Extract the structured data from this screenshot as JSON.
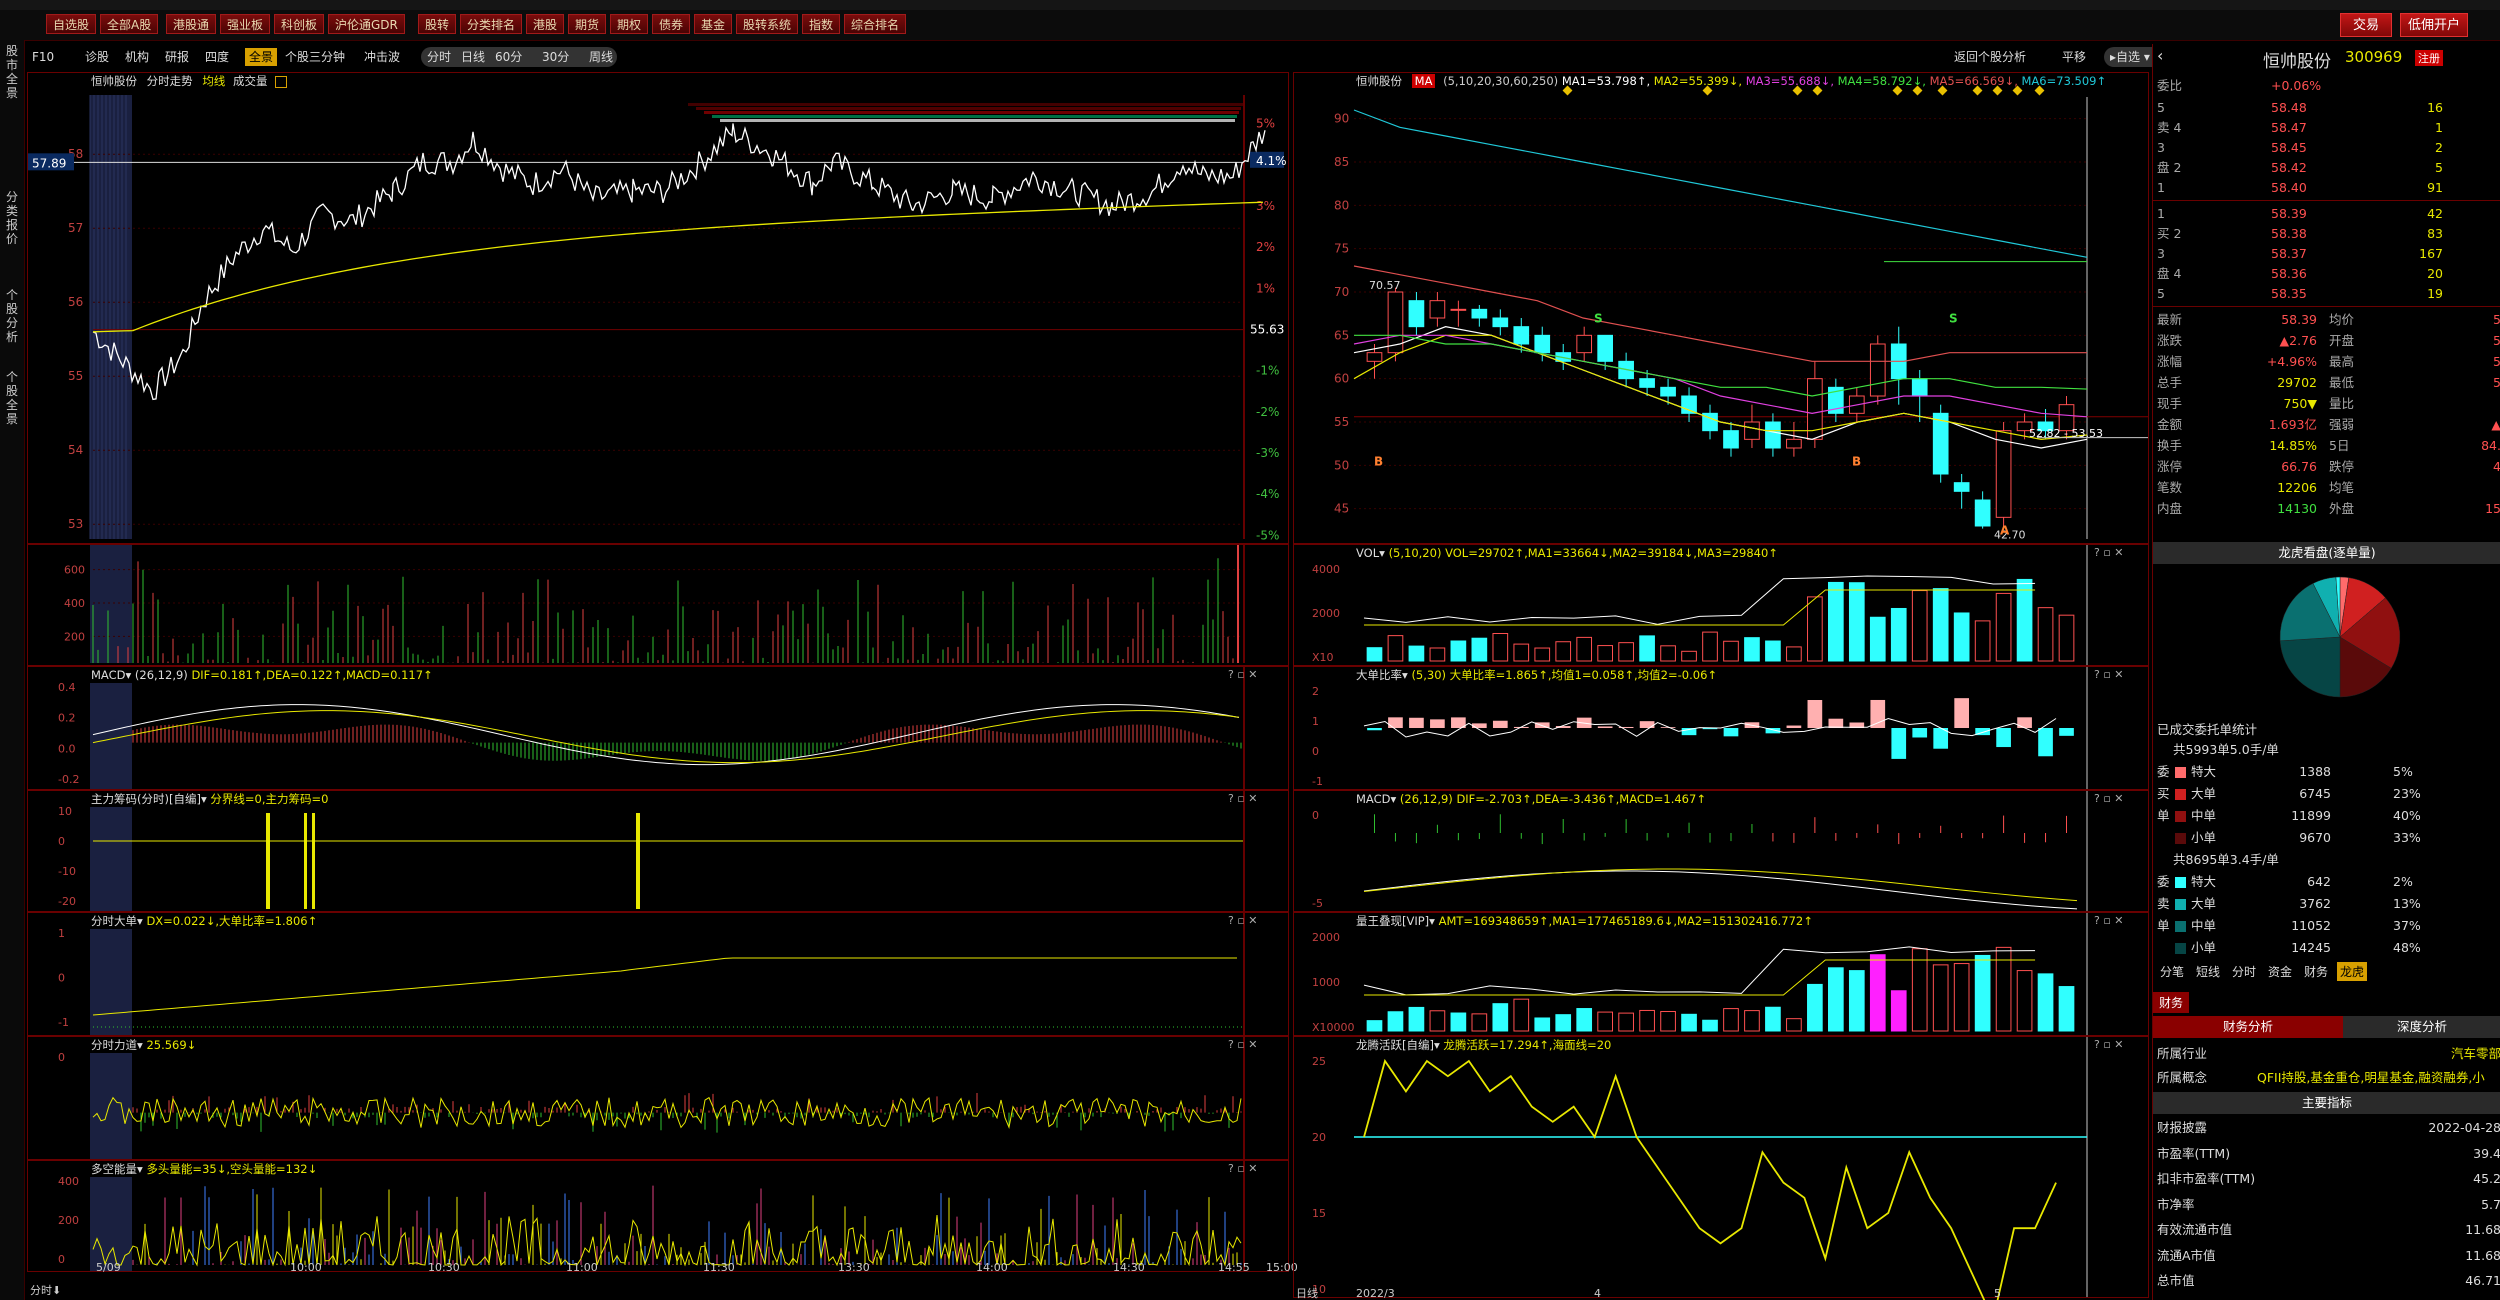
{
  "menubar": {
    "items": [
      "自选股",
      "全部A股",
      "港股通",
      "强业板",
      "科创板",
      "沪伦通GDR",
      "股转",
      "分类排名",
      "港股",
      "期货",
      "期权",
      "债券",
      "基金",
      "股转系统",
      "指数",
      "综合排名"
    ],
    "trade_btn": "交易",
    "open_btn": "低佣开户"
  },
  "vtabs": [
    "股市全景",
    "分类报价",
    "个股分析",
    "个股全景"
  ],
  "toolbar": {
    "left_items": [
      "F10",
      "诊股",
      "机构",
      "研报",
      "四度",
      "全景",
      "个股三分钟",
      "冲击波"
    ],
    "selected": "全景",
    "periods": [
      "分时",
      "日线",
      "60分",
      "30分",
      "周线"
    ],
    "right_items": [
      "返回个股分析",
      "平移",
      "自选"
    ]
  },
  "intraday": {
    "header": {
      "name": "恒帅股份",
      "chart": "分时走势",
      "avg": "均线",
      "vol": "成交量"
    },
    "price_labels": [
      "58",
      "57",
      "56",
      "55",
      "54",
      "53"
    ],
    "pct_labels": [
      "5%",
      "4.1%",
      "3%",
      "2%",
      "1%",
      "-1%",
      "-2%",
      "-3%",
      "-4%",
      "-5%"
    ],
    "ref_price": "55.63",
    "cursor_price": "57.89",
    "vol_labels": [
      "600",
      "400",
      "200"
    ],
    "time_labels": [
      "5/09",
      "10:00",
      "10:30",
      "11:00",
      "11:30",
      "13:30",
      "14:00",
      "14:30",
      "14:55",
      "15:00"
    ],
    "bottom_left": "分时"
  },
  "indicators_left": [
    {
      "name": "MACD",
      "params": "(26,12,9)",
      "vals": "DIF=0.181↑,DEA=0.122↑,MACD=0.117↑",
      "ylabels": [
        "0.4",
        "0.2",
        "0.0",
        "-0.2"
      ]
    },
    {
      "name": "主力筹码(分时)[自编]",
      "params": "",
      "vals": "分界线=0,主力筹码=0",
      "ylabels": [
        "10",
        "0",
        "-10",
        "-20"
      ]
    },
    {
      "name": "分时大单",
      "params": "",
      "vals": "DX=0.022↓,大单比率=1.806↑",
      "ylabels": [
        "1",
        "0",
        "-1"
      ]
    },
    {
      "name": "分时力道",
      "params": "",
      "vals": "25.569↓",
      "ylabels": [
        "0"
      ]
    },
    {
      "name": "多空能量",
      "params": "",
      "vals": "多头量能=35↓,空头量能=132↓",
      "ylabels": [
        "400",
        "200",
        "0"
      ]
    }
  ],
  "daily": {
    "header": {
      "name": "恒帅股份",
      "ma": "MA",
      "params": "(5,10,20,30,60,250)",
      "vals": [
        "MA1=53.798↑",
        "MA2=55.399↓",
        "MA3=55.688↓",
        "MA4=58.792↓",
        "MA5=66.569↓",
        "MA6=73.509↑"
      ]
    },
    "price_labels": [
      "90",
      "85",
      "80",
      "75",
      "70",
      "65",
      "60",
      "55",
      "50",
      "45"
    ],
    "high_label": "70.57",
    "low_label": "42.70",
    "range_label": "52.82 - 53.53",
    "date_labels": [
      "日线",
      "2022/3",
      "4",
      "5"
    ],
    "colors": {
      "ma1": "#ffffff",
      "ma2": "#e8e800",
      "ma3": "#e040e0",
      "ma4": "#40e040",
      "ma5": "#e05050",
      "ma6": "#20c8d8"
    }
  },
  "indicators_right": [
    {
      "name": "VOL",
      "params": "(5,10,20)",
      "vals": "VOL=29702↑,MA1=33664↓,MA2=39184↓,MA3=29840↑",
      "ylabels": [
        "4000",
        "2000",
        "X10"
      ]
    },
    {
      "name": "大单比率",
      "params": "(5,30)",
      "vals": "大单比率=1.865↑,均值1=0.058↑,均值2=-0.06↑",
      "ylabels": [
        "2",
        "1",
        "0",
        "-1"
      ]
    },
    {
      "name": "MACD",
      "params": "(26,12,9)",
      "vals": "DIF=-2.703↑,DEA=-3.436↑,MACD=1.467↑",
      "ylabels": [
        "0",
        "-5"
      ]
    },
    {
      "name": "量王叠现[VIP]",
      "params": "",
      "vals": "AMT=169348659↑,MA1=177465189.6↓,MA2=151302416.772↑",
      "ylabels": [
        "2000",
        "1000",
        "X10000"
      ]
    },
    {
      "name": "龙腾活跃[自编]",
      "params": "",
      "vals": "龙腾活跃=17.294↑,海面线=20",
      "ylabels": [
        "25",
        "20",
        "15",
        "10"
      ]
    }
  ],
  "quote": {
    "stock_name": "恒帅股份",
    "stock_code": "300969",
    "badge": "注册",
    "weibi_label": "委比",
    "weibi_val": "+0.06%",
    "asks": [
      {
        "label": "5",
        "price": "58.48",
        "vol": "16"
      },
      {
        "label": "卖 4",
        "price": "58.47",
        "vol": "1"
      },
      {
        "label": "3",
        "price": "58.45",
        "vol": "2"
      },
      {
        "label": "盘 2",
        "price": "58.42",
        "vol": "5"
      },
      {
        "label": "1",
        "price": "58.40",
        "vol": "91"
      }
    ],
    "bids": [
      {
        "label": "1",
        "price": "58.39",
        "vol": "42"
      },
      {
        "label": "买 2",
        "price": "58.38",
        "vol": "83"
      },
      {
        "label": "3",
        "price": "58.37",
        "vol": "167"
      },
      {
        "label": "盘 4",
        "price": "58.36",
        "vol": "20"
      },
      {
        "label": "5",
        "price": "58.35",
        "vol": "19"
      }
    ],
    "stats": [
      {
        "k1": "最新",
        "v1": "58.39",
        "k2": "均价",
        "v2": "5"
      },
      {
        "k1": "涨跌",
        "v1": "▲2.76",
        "k2": "开盘",
        "v2": "5"
      },
      {
        "k1": "涨幅",
        "v1": "+4.96%",
        "k2": "最高",
        "v2": "5"
      },
      {
        "k1": "总手",
        "v1": "29702",
        "k2": "最低",
        "v2": "5"
      },
      {
        "k1": "现手",
        "v1": "750▼",
        "k2": "量比",
        "v2": ""
      },
      {
        "k1": "金额",
        "v1": "1.693亿",
        "k2": "强弱",
        "v2": "▲"
      },
      {
        "k1": "换手",
        "v1": "14.85%",
        "k2": "5日",
        "v2": "84."
      },
      {
        "k1": "涨停",
        "v1": "66.76",
        "k2": "跌停",
        "v2": "4"
      },
      {
        "k1": "笔数",
        "v1": "12206",
        "k2": "均笔",
        "v2": ""
      },
      {
        "k1": "内盘",
        "v1": "14130",
        "k2": "外盘",
        "v2": "15"
      }
    ],
    "dragon_title": "龙虎看盘(逐单量)",
    "order_stats_title": "已成交委托单统计",
    "buy_total": "共5993单5.0手/单",
    "buy_rows": [
      {
        "side": "委",
        "type": "特大",
        "n": "1388",
        "pct": "5%",
        "color": "#ff6b6b"
      },
      {
        "side": "买",
        "type": "大单",
        "n": "6745",
        "pct": "23%",
        "color": "#d02020"
      },
      {
        "side": "单",
        "type": "中单",
        "n": "11899",
        "pct": "40%",
        "color": "#901010"
      },
      {
        "side": "",
        "type": "小单",
        "n": "9670",
        "pct": "33%",
        "color": "#5a0a0a"
      }
    ],
    "sell_total": "共8695单3.4手/单",
    "sell_rows": [
      {
        "side": "委",
        "type": "特大",
        "n": "642",
        "pct": "2%",
        "color": "#30ffff"
      },
      {
        "side": "卖",
        "type": "大单",
        "n": "3762",
        "pct": "13%",
        "color": "#10b0b0"
      },
      {
        "side": "单",
        "type": "中单",
        "n": "11052",
        "pct": "37%",
        "color": "#0a7070"
      },
      {
        "side": "",
        "type": "小单",
        "n": "14245",
        "pct": "48%",
        "color": "#064545"
      }
    ],
    "tabs": [
      "分笔",
      "短线",
      "分时",
      "资金",
      "财务",
      "龙虎"
    ],
    "tabs_selected": "龙虎",
    "fin_tab": "财务",
    "fin_subtabs": [
      "财务分析",
      "深度分析"
    ],
    "industry_label": "所属行业",
    "industry_val": "汽车零部",
    "concept_label": "所属概念",
    "concept_val": "QFII持股,基金重仓,明星基金,融资融券,小",
    "indicators_title": "主要指标",
    "fin_rows": [
      {
        "k": "财报披露",
        "v": "2022-04-28"
      },
      {
        "k": "市盈率(TTM)",
        "v": "39.4"
      },
      {
        "k": "扣非市盈率(TTM)",
        "v": "45.2"
      },
      {
        "k": "市净率",
        "v": "5.7"
      },
      {
        "k": "有效流通市值",
        "v": "11.68"
      },
      {
        "k": "流通A市值",
        "v": "11.68"
      },
      {
        "k": "总市值",
        "v": "46.71"
      }
    ]
  }
}
